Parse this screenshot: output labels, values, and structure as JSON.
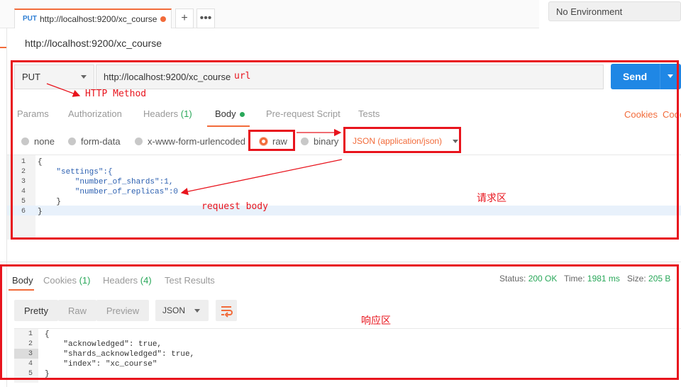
{
  "top_tab": {
    "method": "PUT",
    "url": "http://localhost:9200/xc_course"
  },
  "environment": "No Environment",
  "request_name": "http://localhost:9200/xc_course",
  "request": {
    "method": "PUT",
    "url": "http://localhost:9200/xc_course",
    "send_label": "Send",
    "tabs": [
      {
        "label": "Params"
      },
      {
        "label": "Authorization"
      },
      {
        "label": "Headers",
        "count": "(1)"
      },
      {
        "label": "Body"
      },
      {
        "label": "Pre-request Script"
      },
      {
        "label": "Tests"
      }
    ],
    "right_links": [
      "Cookies",
      "Code"
    ],
    "body_types": [
      "none",
      "form-data",
      "x-www-form-urlencoded",
      "raw",
      "binary"
    ],
    "selected_body_type": "raw",
    "content_type": "JSON (application/json)",
    "code_lines": [
      "{",
      "    \"settings\":{",
      "        \"number_of_shards\":1,",
      "        \"number_of_replicas\":0",
      "    }",
      "}"
    ],
    "line_numbers": [
      "1",
      "2",
      "3",
      "4",
      "5",
      "6"
    ]
  },
  "response": {
    "tabs": [
      {
        "label": "Body"
      },
      {
        "label": "Cookies",
        "count": "(1)"
      },
      {
        "label": "Headers",
        "count": "(4)"
      },
      {
        "label": "Test Results"
      }
    ],
    "status_label": "Status:",
    "status_value": "200 OK",
    "time_label": "Time:",
    "time_value": "1981 ms",
    "size_label": "Size:",
    "size_value": "205 B",
    "view_modes": [
      "Pretty",
      "Raw",
      "Preview"
    ],
    "format": "JSON",
    "code_lines": [
      "{",
      "    \"acknowledged\": true,",
      "    \"shards_acknowledged\": true,",
      "    \"index\": \"xc_course\"",
      "}"
    ],
    "line_numbers": [
      "1",
      "2",
      "3",
      "4",
      "5"
    ]
  },
  "annotations": {
    "url": "url",
    "http_method": "HTTP Method",
    "request_body": "request body",
    "request_area": "请求区",
    "response_area": "响应区"
  },
  "colors": {
    "accent": "#f26b3a",
    "send": "#1f87e5",
    "success": "#2aa85a",
    "annotation": "#e8141d"
  }
}
